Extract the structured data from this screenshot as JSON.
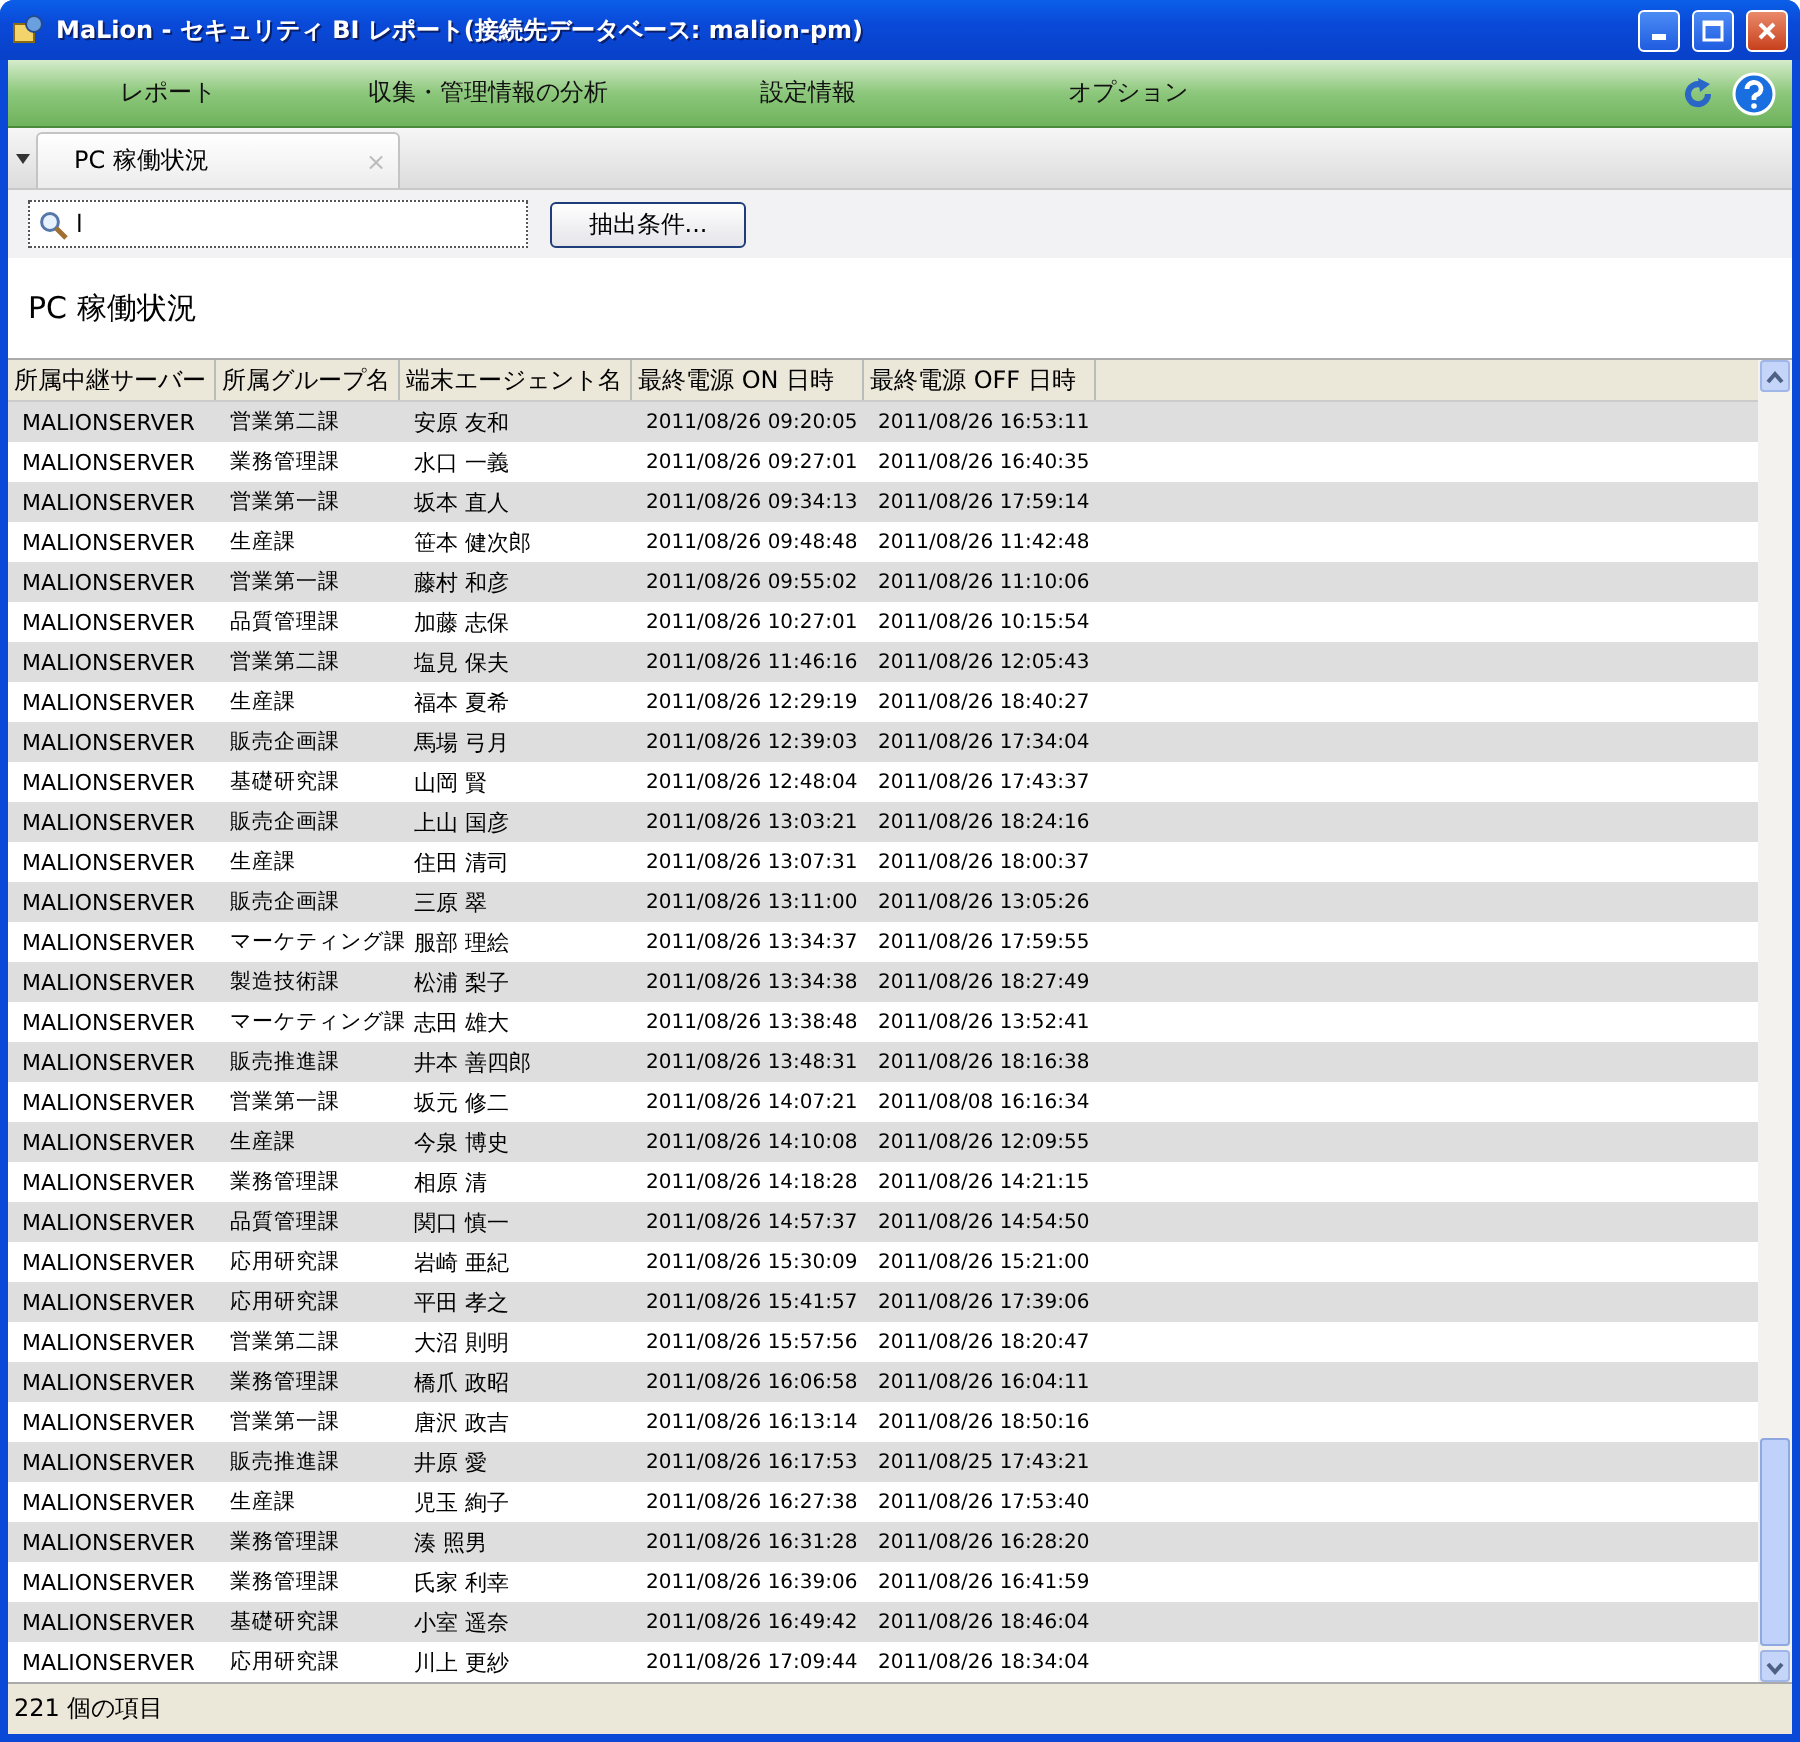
{
  "window": {
    "title": "MaLion - セキュリティ BI レポート(接続先データベース: malion-pm)"
  },
  "menu": [
    "レポート",
    "収集・管理情報の分析",
    "設定情報",
    "オプション"
  ],
  "tabs": [
    {
      "label": "PC 稼働状況",
      "selected": true,
      "close": "×"
    }
  ],
  "search": {
    "value": "l"
  },
  "filter_button": "抽出条件...",
  "heading": "PC 稼働状況",
  "table": {
    "columns": [
      "所属中継サーバー",
      "所属グループ名",
      "端末エージェント名",
      "最終電源 ON 日時",
      "最終電源 OFF 日時"
    ],
    "rows": [
      [
        "MALIONSERVER",
        "営業第二課",
        "安原 友和",
        "2011/08/26 09:20:05",
        "2011/08/26 16:53:11"
      ],
      [
        "MALIONSERVER",
        "業務管理課",
        "水口 一義",
        "2011/08/26 09:27:01",
        "2011/08/26 16:40:35"
      ],
      [
        "MALIONSERVER",
        "営業第一課",
        "坂本 直人",
        "2011/08/26 09:34:13",
        "2011/08/26 17:59:14"
      ],
      [
        "MALIONSERVER",
        "生産課",
        "笹本 健次郎",
        "2011/08/26 09:48:48",
        "2011/08/26 11:42:48"
      ],
      [
        "MALIONSERVER",
        "営業第一課",
        "藤村 和彦",
        "2011/08/26 09:55:02",
        "2011/08/26 11:10:06"
      ],
      [
        "MALIONSERVER",
        "品質管理課",
        "加藤 志保",
        "2011/08/26 10:27:01",
        "2011/08/26 10:15:54"
      ],
      [
        "MALIONSERVER",
        "営業第二課",
        "塩見 保夫",
        "2011/08/26 11:46:16",
        "2011/08/26 12:05:43"
      ],
      [
        "MALIONSERVER",
        "生産課",
        "福本 夏希",
        "2011/08/26 12:29:19",
        "2011/08/26 18:40:27"
      ],
      [
        "MALIONSERVER",
        "販売企画課",
        "馬場 弓月",
        "2011/08/26 12:39:03",
        "2011/08/26 17:34:04"
      ],
      [
        "MALIONSERVER",
        "基礎研究課",
        "山岡 賢",
        "2011/08/26 12:48:04",
        "2011/08/26 17:43:37"
      ],
      [
        "MALIONSERVER",
        "販売企画課",
        "上山 国彦",
        "2011/08/26 13:03:21",
        "2011/08/26 18:24:16"
      ],
      [
        "MALIONSERVER",
        "生産課",
        "住田 清司",
        "2011/08/26 13:07:31",
        "2011/08/26 18:00:37"
      ],
      [
        "MALIONSERVER",
        "販売企画課",
        "三原 翠",
        "2011/08/26 13:11:00",
        "2011/08/26 13:05:26"
      ],
      [
        "MALIONSERVER",
        "マーケティング課",
        "服部 理絵",
        "2011/08/26 13:34:37",
        "2011/08/26 17:59:55"
      ],
      [
        "MALIONSERVER",
        "製造技術課",
        "松浦 梨子",
        "2011/08/26 13:34:38",
        "2011/08/26 18:27:49"
      ],
      [
        "MALIONSERVER",
        "マーケティング課",
        "志田 雄大",
        "2011/08/26 13:38:48",
        "2011/08/26 13:52:41"
      ],
      [
        "MALIONSERVER",
        "販売推進課",
        "井本 善四郎",
        "2011/08/26 13:48:31",
        "2011/08/26 18:16:38"
      ],
      [
        "MALIONSERVER",
        "営業第一課",
        "坂元 修二",
        "2011/08/26 14:07:21",
        "2011/08/08 16:16:34"
      ],
      [
        "MALIONSERVER",
        "生産課",
        "今泉 博史",
        "2011/08/26 14:10:08",
        "2011/08/26 12:09:55"
      ],
      [
        "MALIONSERVER",
        "業務管理課",
        "相原 清",
        "2011/08/26 14:18:28",
        "2011/08/26 14:21:15"
      ],
      [
        "MALIONSERVER",
        "品質管理課",
        "関口 慎一",
        "2011/08/26 14:57:37",
        "2011/08/26 14:54:50"
      ],
      [
        "MALIONSERVER",
        "応用研究課",
        "岩崎 亜紀",
        "2011/08/26 15:30:09",
        "2011/08/26 15:21:00"
      ],
      [
        "MALIONSERVER",
        "応用研究課",
        "平田 孝之",
        "2011/08/26 15:41:57",
        "2011/08/26 17:39:06"
      ],
      [
        "MALIONSERVER",
        "営業第二課",
        "大沼 則明",
        "2011/08/26 15:57:56",
        "2011/08/26 18:20:47"
      ],
      [
        "MALIONSERVER",
        "業務管理課",
        "橋爪 政昭",
        "2011/08/26 16:06:58",
        "2011/08/26 16:04:11"
      ],
      [
        "MALIONSERVER",
        "営業第一課",
        "唐沢 政吉",
        "2011/08/26 16:13:14",
        "2011/08/26 18:50:16"
      ],
      [
        "MALIONSERVER",
        "販売推進課",
        "井原 愛",
        "2011/08/26 16:17:53",
        "2011/08/25 17:43:21"
      ],
      [
        "MALIONSERVER",
        "生産課",
        "児玉 絢子",
        "2011/08/26 16:27:38",
        "2011/08/26 17:53:40"
      ],
      [
        "MALIONSERVER",
        "業務管理課",
        "湊 照男",
        "2011/08/26 16:31:28",
        "2011/08/26 16:28:20"
      ],
      [
        "MALIONSERVER",
        "業務管理課",
        "氏家 利幸",
        "2011/08/26 16:39:06",
        "2011/08/26 16:41:59"
      ],
      [
        "MALIONSERVER",
        "基礎研究課",
        "小室 遥奈",
        "2011/08/26 16:49:42",
        "2011/08/26 18:46:04"
      ],
      [
        "MALIONSERVER",
        "応用研究課",
        "川上 更紗",
        "2011/08/26 17:09:44",
        "2011/08/26 18:34:04"
      ]
    ]
  },
  "status_bar": "221 個の項目"
}
